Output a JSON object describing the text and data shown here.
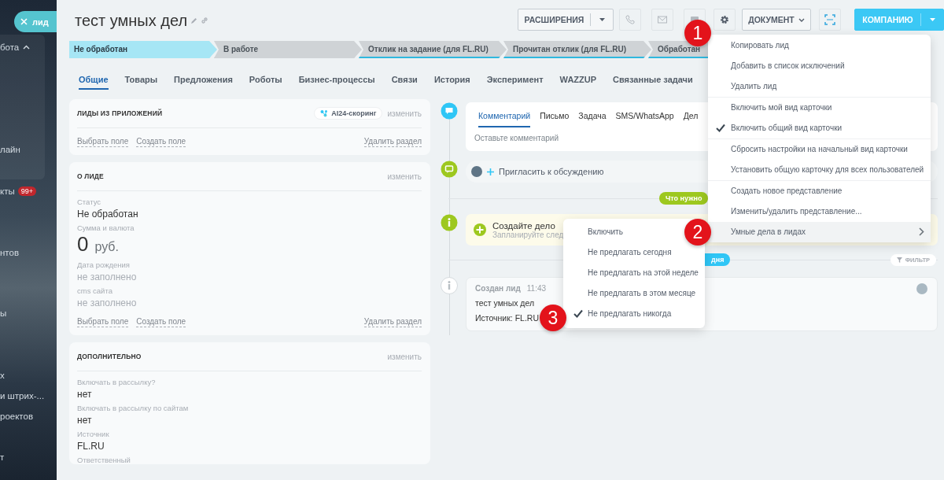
{
  "sidebar": {
    "items": [
      {
        "kind": "group",
        "label": "бота",
        "expanded": true
      },
      {
        "kind": "link",
        "label": "лайн"
      },
      {
        "kind": "link",
        "label": "кты",
        "counter": "99+"
      },
      {
        "kind": "link",
        "label": "нтов"
      },
      {
        "kind": "link",
        "label": "ы"
      },
      {
        "kind": "link",
        "label": "х"
      },
      {
        "kind": "link",
        "label": "и штрих-..."
      },
      {
        "kind": "link",
        "label": "роектов"
      },
      {
        "kind": "link",
        "label": "т"
      }
    ]
  },
  "close_tab": {
    "label": "лид"
  },
  "header": {
    "title": "тест умных дел",
    "extensions_button": "РАСШИРЕНИЯ",
    "document_button": "ДОКУМЕНТ",
    "primary_button": "КОМПАНИЮ"
  },
  "stages": [
    {
      "label": "Не обработан",
      "current": true
    },
    {
      "label": "В работе",
      "current": false
    },
    {
      "label": "Отклик на задание (для FL.RU)",
      "current": false
    },
    {
      "label": "Прочитан отклик (для FL.RU)",
      "current": false
    },
    {
      "label": "Обработан",
      "current": false
    }
  ],
  "tabs": [
    {
      "label": "Общие",
      "selected": true
    },
    {
      "label": "Товары",
      "selected": false
    },
    {
      "label": "Предложения",
      "selected": false
    },
    {
      "label": "Роботы",
      "selected": false
    },
    {
      "label": "Бизнес-процессы",
      "selected": false
    },
    {
      "label": "Связи",
      "selected": false
    },
    {
      "label": "История",
      "selected": false
    },
    {
      "label": "Эксперимент",
      "selected": false
    },
    {
      "label": "WAZZUP",
      "selected": false
    },
    {
      "label": "Связанные задачи",
      "selected": false
    }
  ],
  "sections": [
    {
      "title": "ЛИДЫ ИЗ ПРИЛОЖЕНИЙ",
      "app_badge": "AI24-скоринг",
      "edit": "изменить",
      "actions": [
        "Выбрать поле",
        "Создать поле"
      ],
      "delete": "Удалить раздел"
    },
    {
      "title": "О ЛИДЕ",
      "edit": "изменить",
      "fields": [
        {
          "kind": "text",
          "label": "Статус",
          "value": "Не обработан"
        },
        {
          "kind": "money",
          "label": "Сумма и валюта",
          "value": "0",
          "currency": "руб."
        },
        {
          "kind": "empty",
          "label": "Дата рождения",
          "value": "не заполнено"
        },
        {
          "kind": "empty",
          "label": "cms сайта",
          "value": "не заполнено"
        }
      ],
      "actions": [
        "Выбрать поле",
        "Создать поле"
      ],
      "delete": "Удалить раздел"
    },
    {
      "title": "ДОПОЛНИТЕЛЬНО",
      "edit": "изменить",
      "fields": [
        {
          "kind": "text",
          "label": "Включать в рассылку?",
          "value": "нет"
        },
        {
          "kind": "text",
          "label": "Включать в рассылку по сайтам",
          "value": "нет"
        },
        {
          "kind": "text",
          "label": "Источник",
          "value": "FL.RU"
        },
        {
          "kind": "label",
          "label": "Ответственный"
        }
      ]
    }
  ],
  "timeline": {
    "composer": {
      "tabs": [
        {
          "label": "Комментарий",
          "selected": true
        },
        {
          "label": "Письмо",
          "selected": false
        },
        {
          "label": "Задача",
          "selected": false
        },
        {
          "label": "SMS/WhatsApp",
          "selected": false
        },
        {
          "label": "Дел",
          "selected": false
        }
      ],
      "placeholder": "Оставьте комментарий"
    },
    "invite": "Пригласить к обсуждению",
    "todo_pill": "Что нужно",
    "todo": {
      "title": "Создайте дело",
      "subtitle": "Запланируйте след"
    },
    "day_pill": "дня",
    "filter": "ФИЛЬТР",
    "events": [
      {
        "title": "Создан лид",
        "time": "11:43",
        "lines": [
          "тест умных дел",
          "Источник: FL.RU"
        ]
      }
    ]
  },
  "settings_menu": {
    "items": [
      {
        "label": "Копировать лид",
        "checked": false,
        "highlighted": false,
        "submenu": false,
        "divider": false
      },
      {
        "label": "Добавить в список исключений",
        "checked": false,
        "highlighted": false,
        "submenu": false,
        "divider": false
      },
      {
        "label": "Удалить лид",
        "checked": false,
        "highlighted": false,
        "submenu": false,
        "divider": false
      },
      {
        "label": "Включить мой вид карточки",
        "checked": false,
        "highlighted": false,
        "submenu": false,
        "divider": true
      },
      {
        "label": "Включить общий вид карточки",
        "checked": true,
        "highlighted": false,
        "submenu": false,
        "divider": false
      },
      {
        "label": "Сбросить настройки на начальный вид карточки",
        "checked": false,
        "highlighted": false,
        "submenu": false,
        "divider": true
      },
      {
        "label": "Установить общую карточку для всех пользователей",
        "checked": false,
        "highlighted": false,
        "submenu": false,
        "divider": false
      },
      {
        "label": "Создать новое представление",
        "checked": false,
        "highlighted": false,
        "submenu": false,
        "divider": true
      },
      {
        "label": "Изменить/удалить представление...",
        "checked": false,
        "highlighted": false,
        "submenu": false,
        "divider": false
      },
      {
        "label": "Умные дела в лидах",
        "checked": false,
        "highlighted": true,
        "submenu": true,
        "divider": false
      }
    ]
  },
  "smart_menu": {
    "items": [
      {
        "label": "Включить",
        "checked": false
      },
      {
        "label": "Не предлагать сегодня",
        "checked": false
      },
      {
        "label": "Не предлагать на этой неделе",
        "checked": false
      },
      {
        "label": "Не предлагать в этом месяце",
        "checked": false
      },
      {
        "label": "Не предлагать никогда",
        "checked": true
      }
    ]
  },
  "markers": [
    {
      "label": "1"
    },
    {
      "label": "2"
    },
    {
      "label": "3"
    }
  ]
}
